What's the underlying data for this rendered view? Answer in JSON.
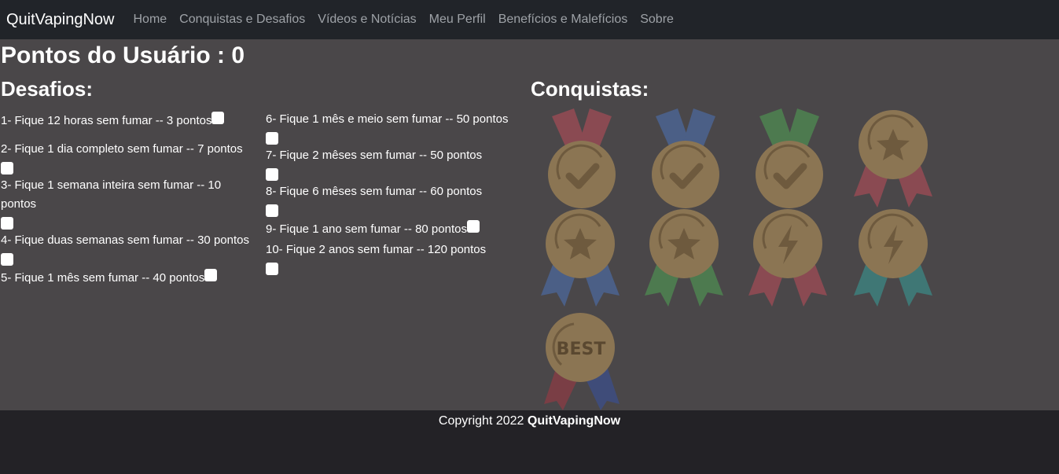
{
  "nav": {
    "brand": "QuitVapingNow",
    "links": [
      "Home",
      "Conquistas e Desafios",
      "Vídeos e Notícias",
      "Meu Perfil",
      "Benefícios e Malefícios",
      "Sobre"
    ]
  },
  "main": {
    "points_label": "Pontos do Usuário : 0",
    "challenges_title": "Desafios:",
    "achievements_title": "Conquistas:",
    "challenges": [
      "1- Fique 12 horas sem fumar -- 3 pontos",
      "2- Fique 1 dia completo sem fumar -- 7 pontos",
      "3- Fique 1 semana inteira sem fumar -- 10 pontos",
      "4- Fique duas semanas sem fumar -- 30 pontos",
      "5- Fique 1 mês sem fumar -- 40 pontos",
      "6- Fique 1 mês e meio sem fumar -- 50 pontos",
      "7- Fique 2 mêses sem fumar -- 50 pontos",
      "8- Fique 6 mêses sem fumar -- 60 pontos",
      "9- Fique 1 ano sem fumar -- 80 pontos",
      "10- Fique 2 anos sem fumar -- 120 pontos"
    ],
    "medals": [
      {
        "icon": "check-icon",
        "ribbon": "#8a4a52"
      },
      {
        "icon": "check-icon",
        "ribbon": "#4b5f86"
      },
      {
        "icon": "check-icon",
        "ribbon": "#4d7a4f"
      },
      {
        "icon": "star-icon",
        "ribbon": "#8a4a52"
      },
      {
        "icon": "star-icon",
        "ribbon": "#4b5f86"
      },
      {
        "icon": "star-icon",
        "ribbon": "#4d7a4f"
      },
      {
        "icon": "bolt-icon",
        "ribbon": "#8a4a52"
      },
      {
        "icon": "bolt-icon",
        "ribbon": "#3f7775"
      },
      {
        "icon": "best-icon",
        "ribbon": "#7a3e45",
        "text": "BEST"
      }
    ],
    "medal_color": "#8b7553"
  },
  "footer": {
    "prefix": "Copyright 2022",
    "brand": "QuitVapingNow"
  }
}
